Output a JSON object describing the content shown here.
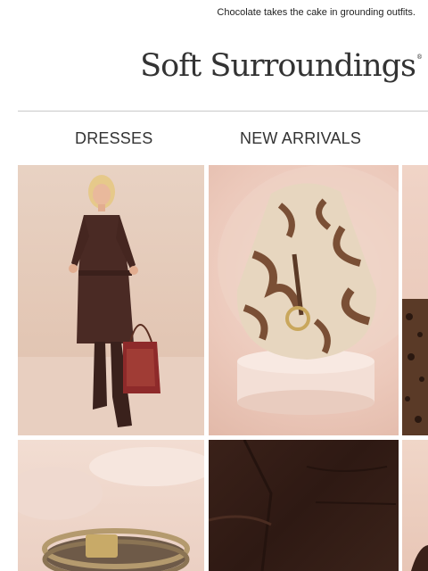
{
  "preheader": {
    "text": "Chocolate takes the cake in grounding outfits."
  },
  "brand": {
    "name": "Soft Surroundings",
    "trademark": "®"
  },
  "nav": {
    "items": [
      {
        "label": "DRESSES"
      },
      {
        "label": "NEW ARRIVALS"
      }
    ]
  },
  "products": [
    {
      "image": "brown suede shirt dress with tapestry tote"
    },
    {
      "image": "zebra print hobo handbag"
    },
    {
      "image": "leopard print top"
    },
    {
      "image": "metallic wrap bracelet"
    },
    {
      "image": "brown suede dress detail"
    },
    {
      "image": "partial product image"
    }
  ],
  "colors": {
    "text": "#333333",
    "divider": "#c9c9c9",
    "chocolate": "#3a2119"
  }
}
